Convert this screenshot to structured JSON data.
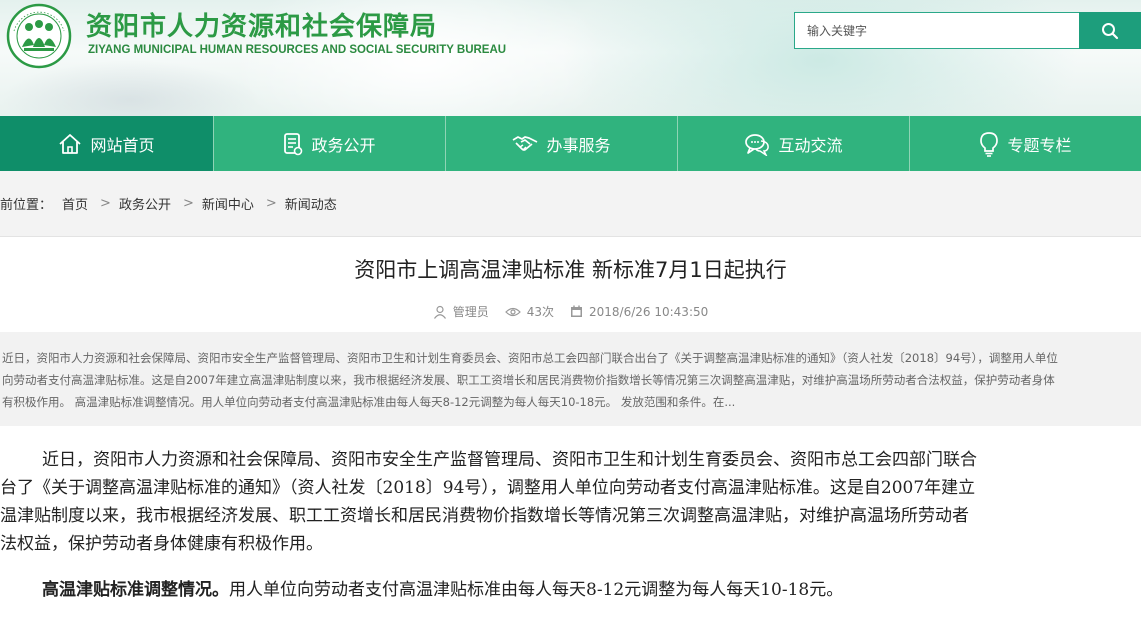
{
  "header": {
    "title": "资阳市人力资源和社会保障局",
    "subtitle": "ZIYANG  MUNICIPAL HUMAN RESOURCES  AND SOCIAL SECURITY BUREAU",
    "logo_text": "民生为本 人才优先",
    "brand_color": "#2c9a45"
  },
  "search": {
    "placeholder": "输入关键字",
    "button_icon": "search-icon"
  },
  "nav": {
    "items": [
      {
        "label": "网站首页",
        "icon": "home-icon",
        "active": true
      },
      {
        "label": "政务公开",
        "icon": "document-icon",
        "active": false
      },
      {
        "label": "办事服务",
        "icon": "handshake-icon",
        "active": false
      },
      {
        "label": "互动交流",
        "icon": "chat-icon",
        "active": false
      },
      {
        "label": "专题专栏",
        "icon": "lightbulb-icon",
        "active": false
      }
    ],
    "bg_color": "#30b37e",
    "active_color": "#0f8e69"
  },
  "breadcrumb": {
    "prefix": "前位置：",
    "items": [
      "首页",
      "政务公开",
      "新闻中心",
      "新闻动态"
    ],
    "separator": ">"
  },
  "article": {
    "title": "资阳市上调高温津贴标准 新标准7月1日起执行",
    "author": "管理员",
    "views": "43次",
    "date": "2018/6/26 10:43:50",
    "summary_lines": [
      "近日，资阳市人力资源和社会保障局、资阳市安全生产监督管理局、资阳市卫生和计划生育委员会、资阳市总工会四部门联合出台了《关于调整高温津贴标准的通知》（资人社发〔2018〕94号），调整用人单位",
      "向劳动者支付高温津贴标准。这是自2007年建立高温津贴制度以来，我市根据经济发展、职工工资增长和居民消费物价指数增长等情况第三次调整高温津贴，对维护高温场所劳动者合法权益，保护劳动者身体",
      "有积极作用。 高温津贴标准调整情况。用人单位向劳动者支付高温津贴标准由每人每天8-12元调整为每人每天10-18元。 发放范围和条件。在..."
    ],
    "body_para1_lines": [
      "近日，资阳市人力资源和社会保障局、资阳市安全生产监督管理局、资阳市卫生和计划生育委员会、资阳市总工会四部门联合",
      "台了《关于调整高温津贴标准的通知》（资人社发〔2018〕94号），调整用人单位向劳动者支付高温津贴标准。这是自2007年建立",
      "温津贴制度以来，我市根据经济发展、职工工资增长和居民消费物价指数增长等情况第三次调整高温津贴，对维护高温场所劳动者",
      "法权益，保护劳动者身体健康有积极作用。"
    ],
    "body_para2_lead": "高温津贴标准调整情况。",
    "body_para2_rest": "用人单位向劳动者支付高温津贴标准由每人每天8-12元调整为每人每天10-18元。"
  }
}
